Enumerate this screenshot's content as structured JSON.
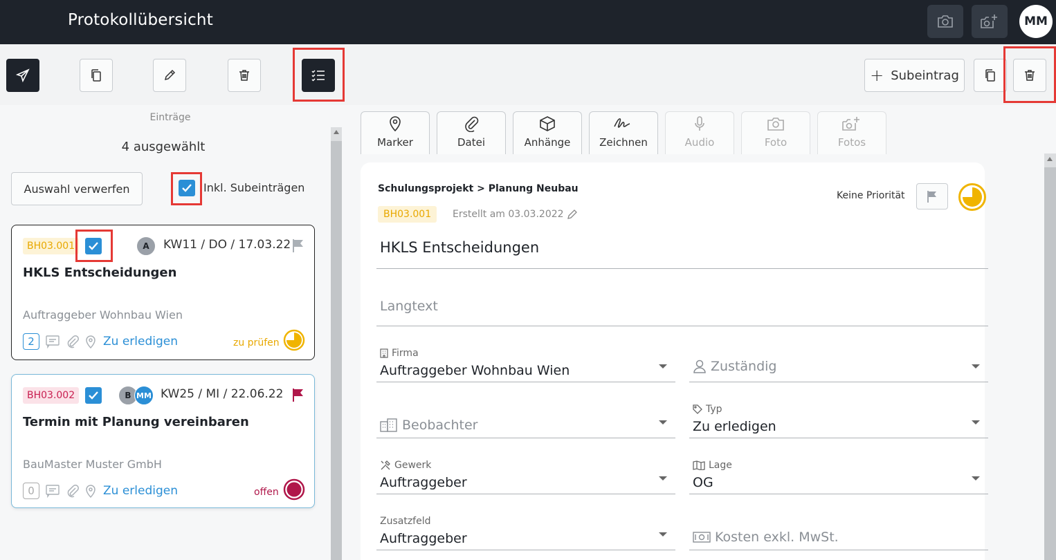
{
  "header": {
    "title": "Protokollübersicht",
    "avatar": "MM"
  },
  "toolbar": {
    "sub_entry_label": "Subeintrag"
  },
  "list": {
    "section_label": "Einträge",
    "selected_count": "4 ausgewählt",
    "discard_label": "Auswahl verwerfen",
    "include_sub_label": "Inkl. Subeinträgen",
    "cards": [
      {
        "id": "BH03.001",
        "avatars": [
          "A"
        ],
        "date": "KW11 / DO / 17.03.22",
        "title": "HKLS Entscheidungen",
        "company": "Auftraggeber Wohnbau Wien",
        "count": "2",
        "type": "Zu erledigen",
        "status": "zu prüfen",
        "status_color": "#e8a800"
      },
      {
        "id": "BH03.002",
        "avatars": [
          "B",
          "MM"
        ],
        "date": "KW25 / MI / 22.06.22",
        "title": "Termin mit Planung vereinbaren",
        "company": "BauMaster Muster GmbH",
        "count": "0",
        "type": "Zu erledigen",
        "status": "offen",
        "status_color": "#b0174a"
      }
    ]
  },
  "tabs": [
    {
      "label": "Marker",
      "icon": "marker-icon"
    },
    {
      "label": "Datei",
      "icon": "paperclip-icon"
    },
    {
      "label": "Anhänge",
      "icon": "box-icon"
    },
    {
      "label": "Zeichnen",
      "icon": "signature-icon"
    },
    {
      "label": "Audio",
      "icon": "microphone-icon"
    },
    {
      "label": "Foto",
      "icon": "camera-icon"
    },
    {
      "label": "Fotos",
      "icon": "camera-plus-icon"
    }
  ],
  "detail": {
    "breadcrumb": "Schulungsprojekt > Planung Neubau",
    "id": "BH03.001",
    "created": "Erstellt am 03.03.2022",
    "priority_label": "Keine Priorität",
    "title": "HKLS Entscheidungen",
    "longtext_placeholder": "Langtext",
    "fields": {
      "firma_label": "Firma",
      "firma_value": "Auftraggeber Wohnbau Wien",
      "zustaendig_placeholder": "Zuständig",
      "beobachter_placeholder": "Beobachter",
      "typ_label": "Typ",
      "typ_value": "Zu erledigen",
      "gewerk_label": "Gewerk",
      "gewerk_value": "Auftraggeber",
      "lage_label": "Lage",
      "lage_value": "OG",
      "zusatz_label": "Zusatzfeld",
      "zusatz_value": "Auftraggeber",
      "kosten_placeholder": "Kosten exkl. MwSt."
    }
  },
  "colors": {
    "header_bg": "#1e232b",
    "accent_blue": "#2b8fd6",
    "highlight_red": "#e53935",
    "pending_yellow": "#e8a800",
    "open_red": "#b0174a"
  }
}
